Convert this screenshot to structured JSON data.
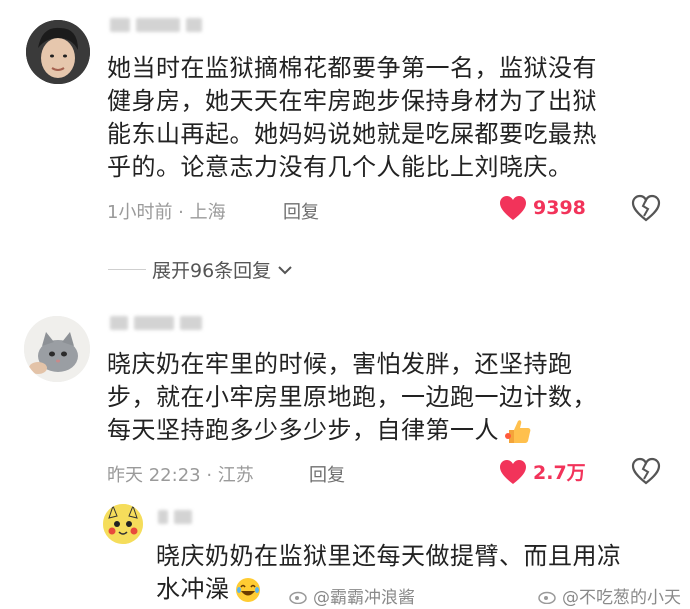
{
  "comments": [
    {
      "text_lines": [
        "她当时在监狱摘棉花都要争第一名，监狱没有",
        "健身房，她天天在牢房跑步保持身材为了出狱",
        "能东山再起。她妈妈说她就是吃屎都要吃最热",
        "乎的。论意志力没有几个人能比上刘晓庆。"
      ],
      "meta": "1小时前 · 上海",
      "reply_label": "回复",
      "likes": "9398"
    },
    {
      "text_lines": [
        "晓庆奶在牢里的时候，害怕发胖，还坚持跑",
        "步，就在小牢房里原地跑，一边跑一边计数，",
        "每天坚持跑多少多少步，自律第一人"
      ],
      "meta": "昨天 22:23 · 江苏",
      "reply_label": "回复",
      "likes": "2.7万"
    },
    {
      "text_lines": [
        "晓庆奶奶在监狱里还每天做提臂、而且用凉",
        "水冲澡"
      ]
    }
  ],
  "expand_replies": "展开96条回复",
  "watermarks": [
    "@霸霸冲浪酱",
    "@不吃葱的小天"
  ],
  "colors": {
    "like": "#f2335a",
    "meta": "#9a9a9a"
  },
  "icons": [
    "heart-icon",
    "broken-heart-icon",
    "chevron-down-icon",
    "thumbs-up-emoji",
    "laughing-emoji",
    "weibo-icon"
  ]
}
